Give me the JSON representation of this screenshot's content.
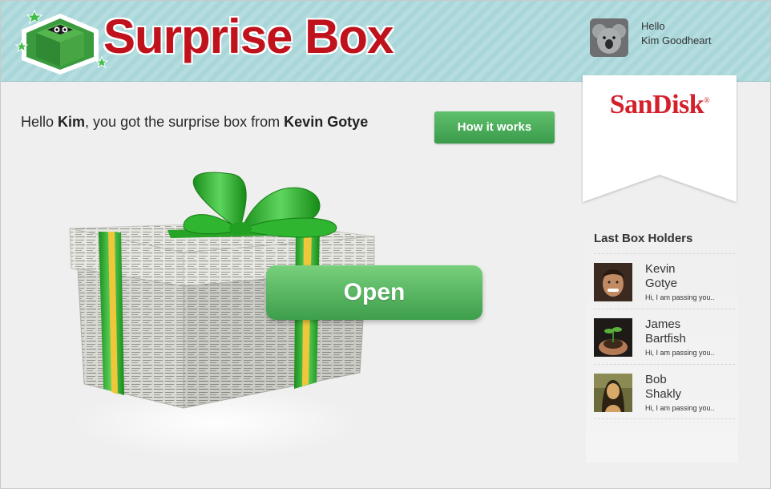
{
  "app": {
    "title": "Surprise Box"
  },
  "header": {
    "logo_text": "Surprise Box",
    "user": {
      "greeting": "Hello",
      "name": "Kim Goodheart"
    }
  },
  "sponsor": {
    "name": "SanDisk"
  },
  "main": {
    "greeting_prefix": "Hello ",
    "greeting_name": "Kim",
    "greeting_middle": ", you got the surprise box from ",
    "greeting_sender": "Kevin Gotye",
    "how_button": "How it works",
    "open_button": "Open"
  },
  "holders": {
    "title": "Last Box Holders",
    "items": [
      {
        "first": "Kevin",
        "last": "Gotye",
        "message": "Hi, I am passing you.."
      },
      {
        "first": "James",
        "last": "Bartfish",
        "message": "Hi, I am passing you.."
      },
      {
        "first": "Bob",
        "last": "Shakly",
        "message": "Hi, I am passing you.."
      }
    ]
  },
  "colors": {
    "brand_red": "#c0121c",
    "accent_green": "#4caf50",
    "header_teal": "#aed9dc",
    "sponsor_red": "#d3202b"
  }
}
